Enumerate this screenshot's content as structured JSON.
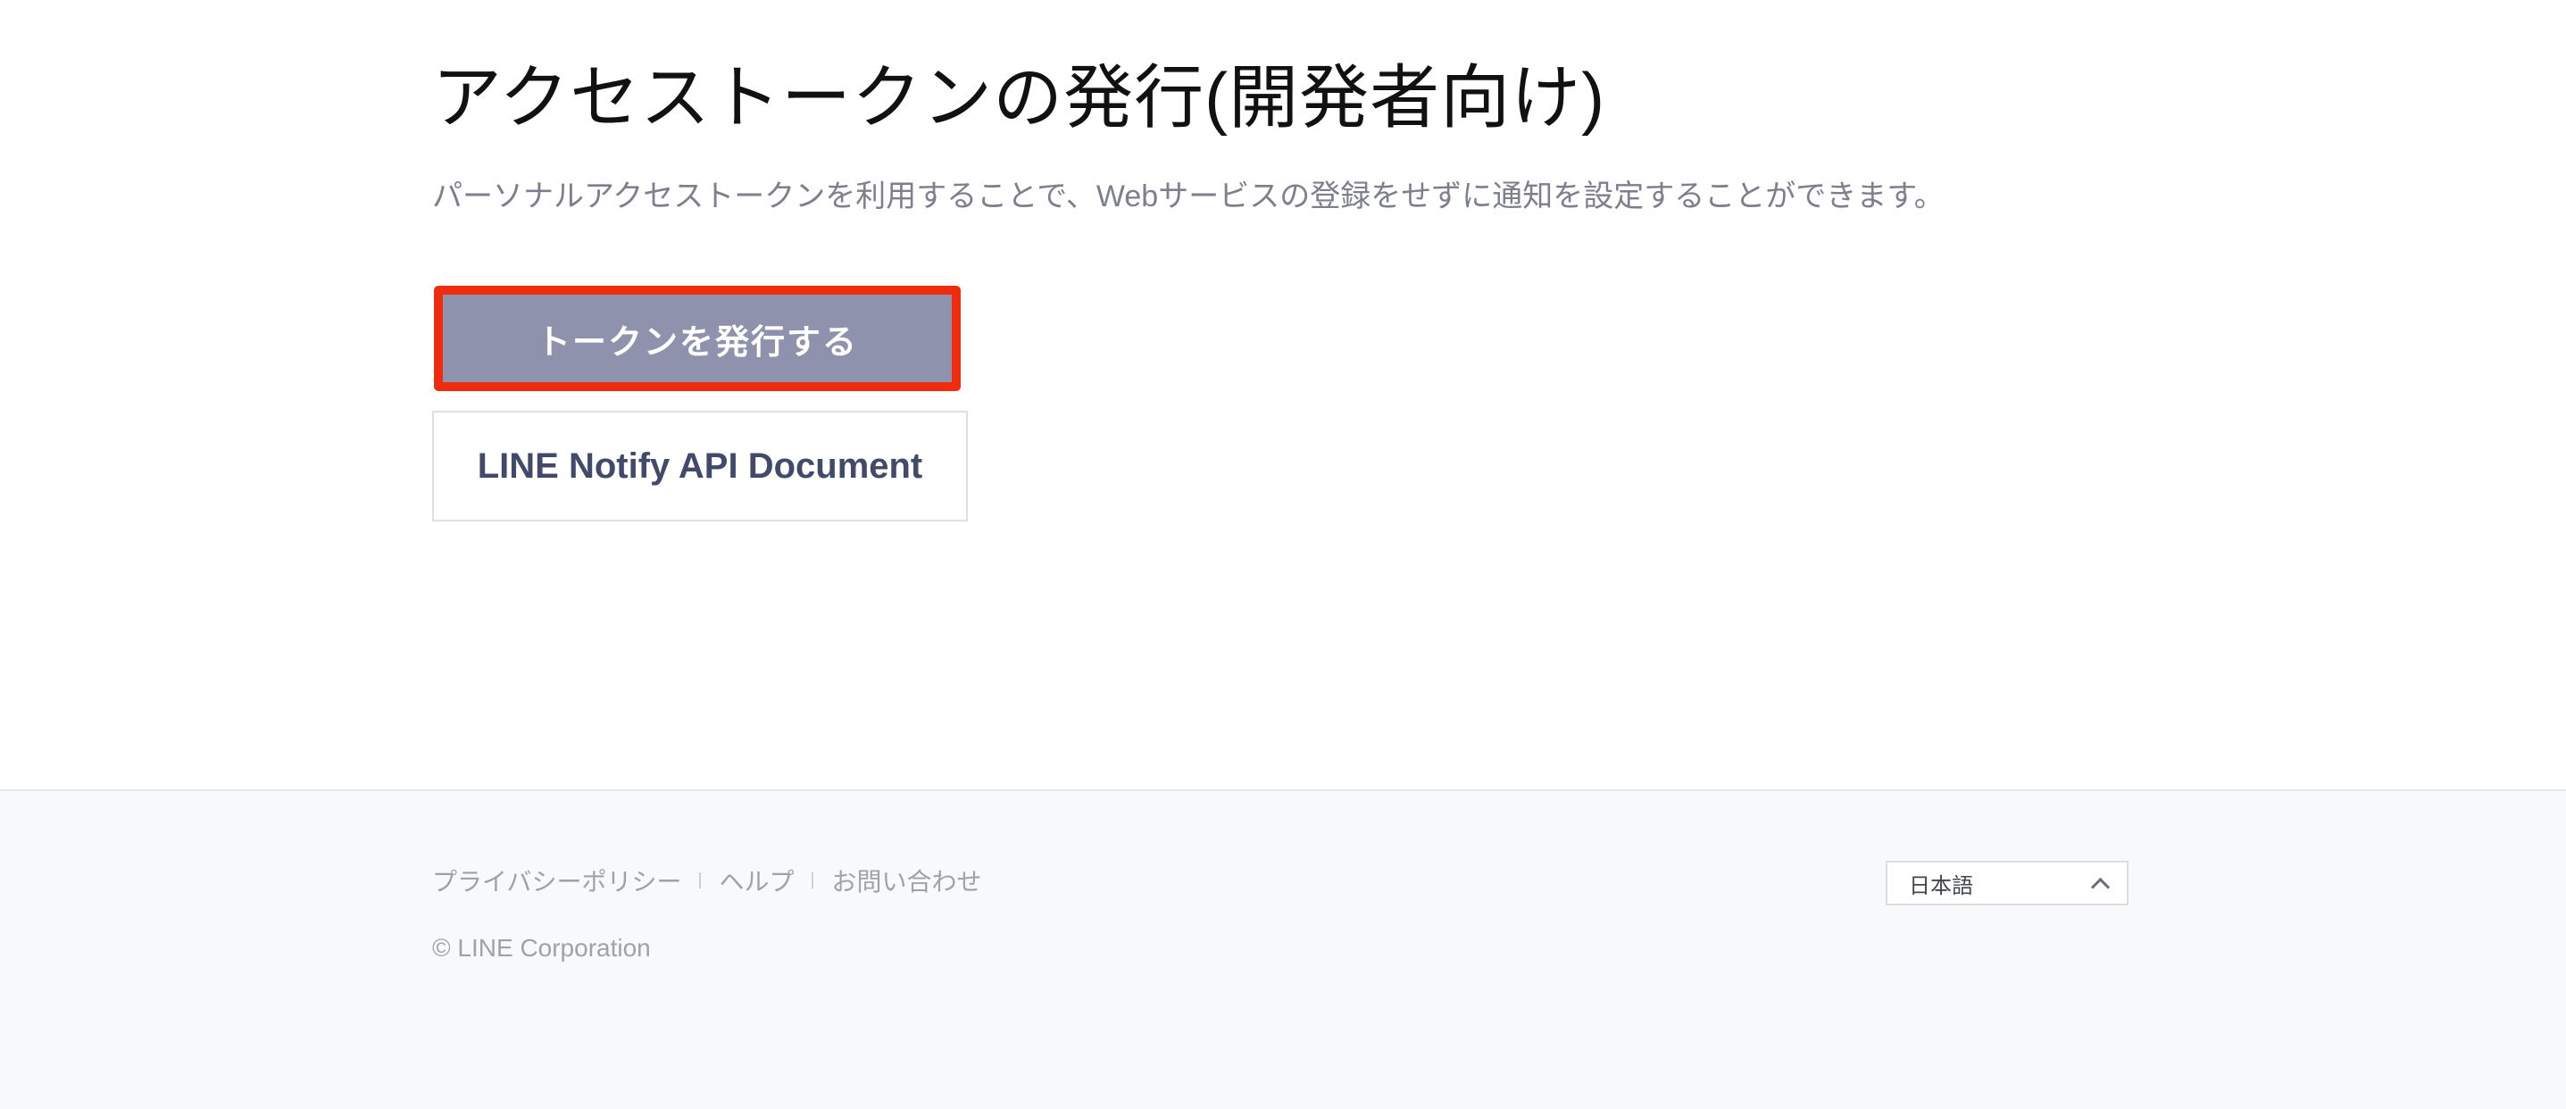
{
  "main": {
    "title": "アクセストークンの発行(開発者向け)",
    "description": "パーソナルアクセストークンを利用することで、Webサービスの登録をせずに通知を設定することができます。",
    "issue_token_button": "トークンを発行する",
    "api_doc_button": "LINE Notify API Document"
  },
  "footer": {
    "links": [
      "プライバシーポリシー",
      "ヘルプ",
      "お問い合わせ"
    ],
    "copyright": "© LINE Corporation",
    "language": {
      "selected": "日本語",
      "icon": "chevron-up-icon"
    }
  },
  "colors": {
    "primary_button": "#8f92ac",
    "highlight_border": "#ef2d0e",
    "doc_button_text": "#424a6b",
    "footer_bg": "#f8f9fb"
  }
}
